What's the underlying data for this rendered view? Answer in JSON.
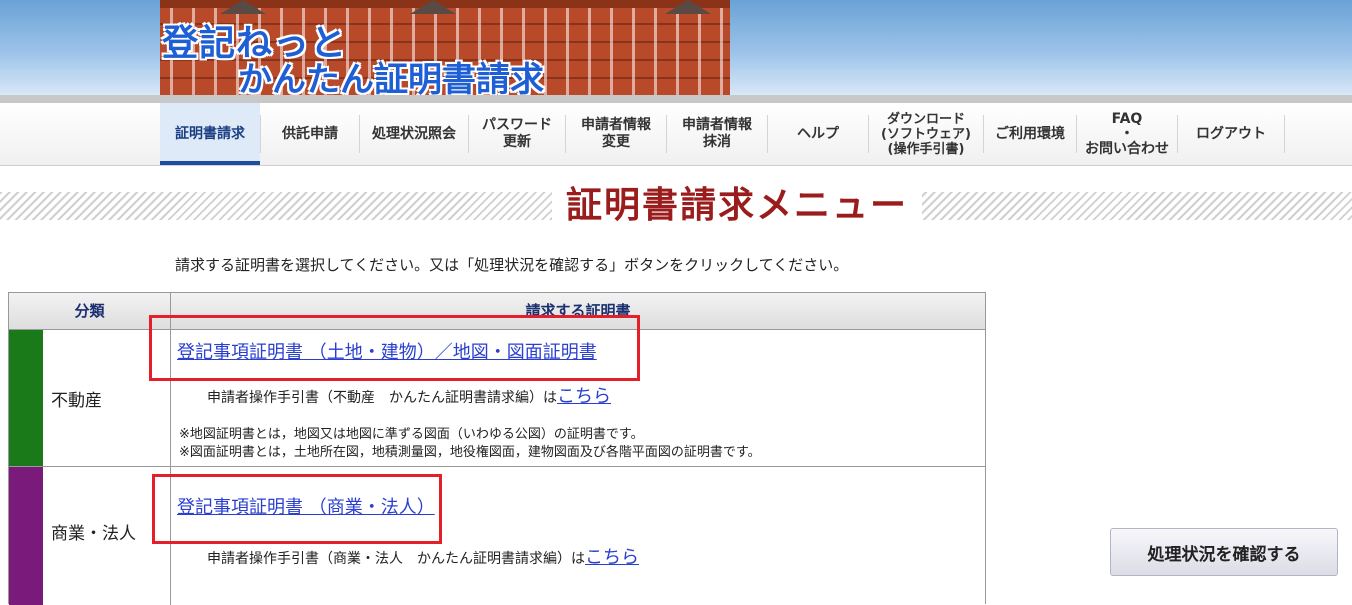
{
  "header": {
    "logo_line1": "登記ねっと",
    "logo_line2": "かんたん証明書請求"
  },
  "nav": {
    "items": [
      {
        "label": "証明書請求",
        "active": true
      },
      {
        "label": "供託申請"
      },
      {
        "label": "処理状況照会"
      },
      {
        "label": "パスワード\n更新"
      },
      {
        "label": "申請者情報\n変更"
      },
      {
        "label": "申請者情報\n抹消"
      },
      {
        "label": "ヘルプ"
      },
      {
        "label": "ダウンロード\n(ソフトウェア)\n(操作手引書)"
      },
      {
        "label": "ご利用環境"
      },
      {
        "label": "FAQ\n・\nお問い合わせ"
      },
      {
        "label": "ログアウト"
      }
    ]
  },
  "page": {
    "title": "証明書請求メニュー",
    "instruction": "請求する証明書を選択してください。又は「処理状況を確認する」ボタンをクリックしてください。"
  },
  "table": {
    "headers": [
      "分類",
      "請求する証明書"
    ],
    "rows": [
      {
        "category": "不動産",
        "color": "#1a7a1a",
        "cert_link": "登記事項証明書 （土地・建物）／地図・図面証明書",
        "manual_text": "申請者操作手引書（不動産　かんたん証明書請求編）は",
        "manual_link": "こちら",
        "notes": [
          "※地図証明書とは，地図又は地図に準ずる図面（いわゆる公図）の証明書です。",
          "※図面証明書とは，土地所在図，地積測量図，地役権図面，建物図面及び各階平面図の証明書です。"
        ]
      },
      {
        "category": "商業・法人",
        "color": "#7a1a7a",
        "cert_link": "登記事項証明書 （商業・法人）",
        "manual_text": "申請者操作手引書（商業・法人　かんたん証明書請求編）は",
        "manual_link": "こちら"
      }
    ]
  },
  "status_button": "処理状況を確認する",
  "colors": {
    "title": "#9a1c1c",
    "link": "#2a3fd0",
    "highlight": "#e51f2a",
    "nav_active": "#1e4da0"
  }
}
